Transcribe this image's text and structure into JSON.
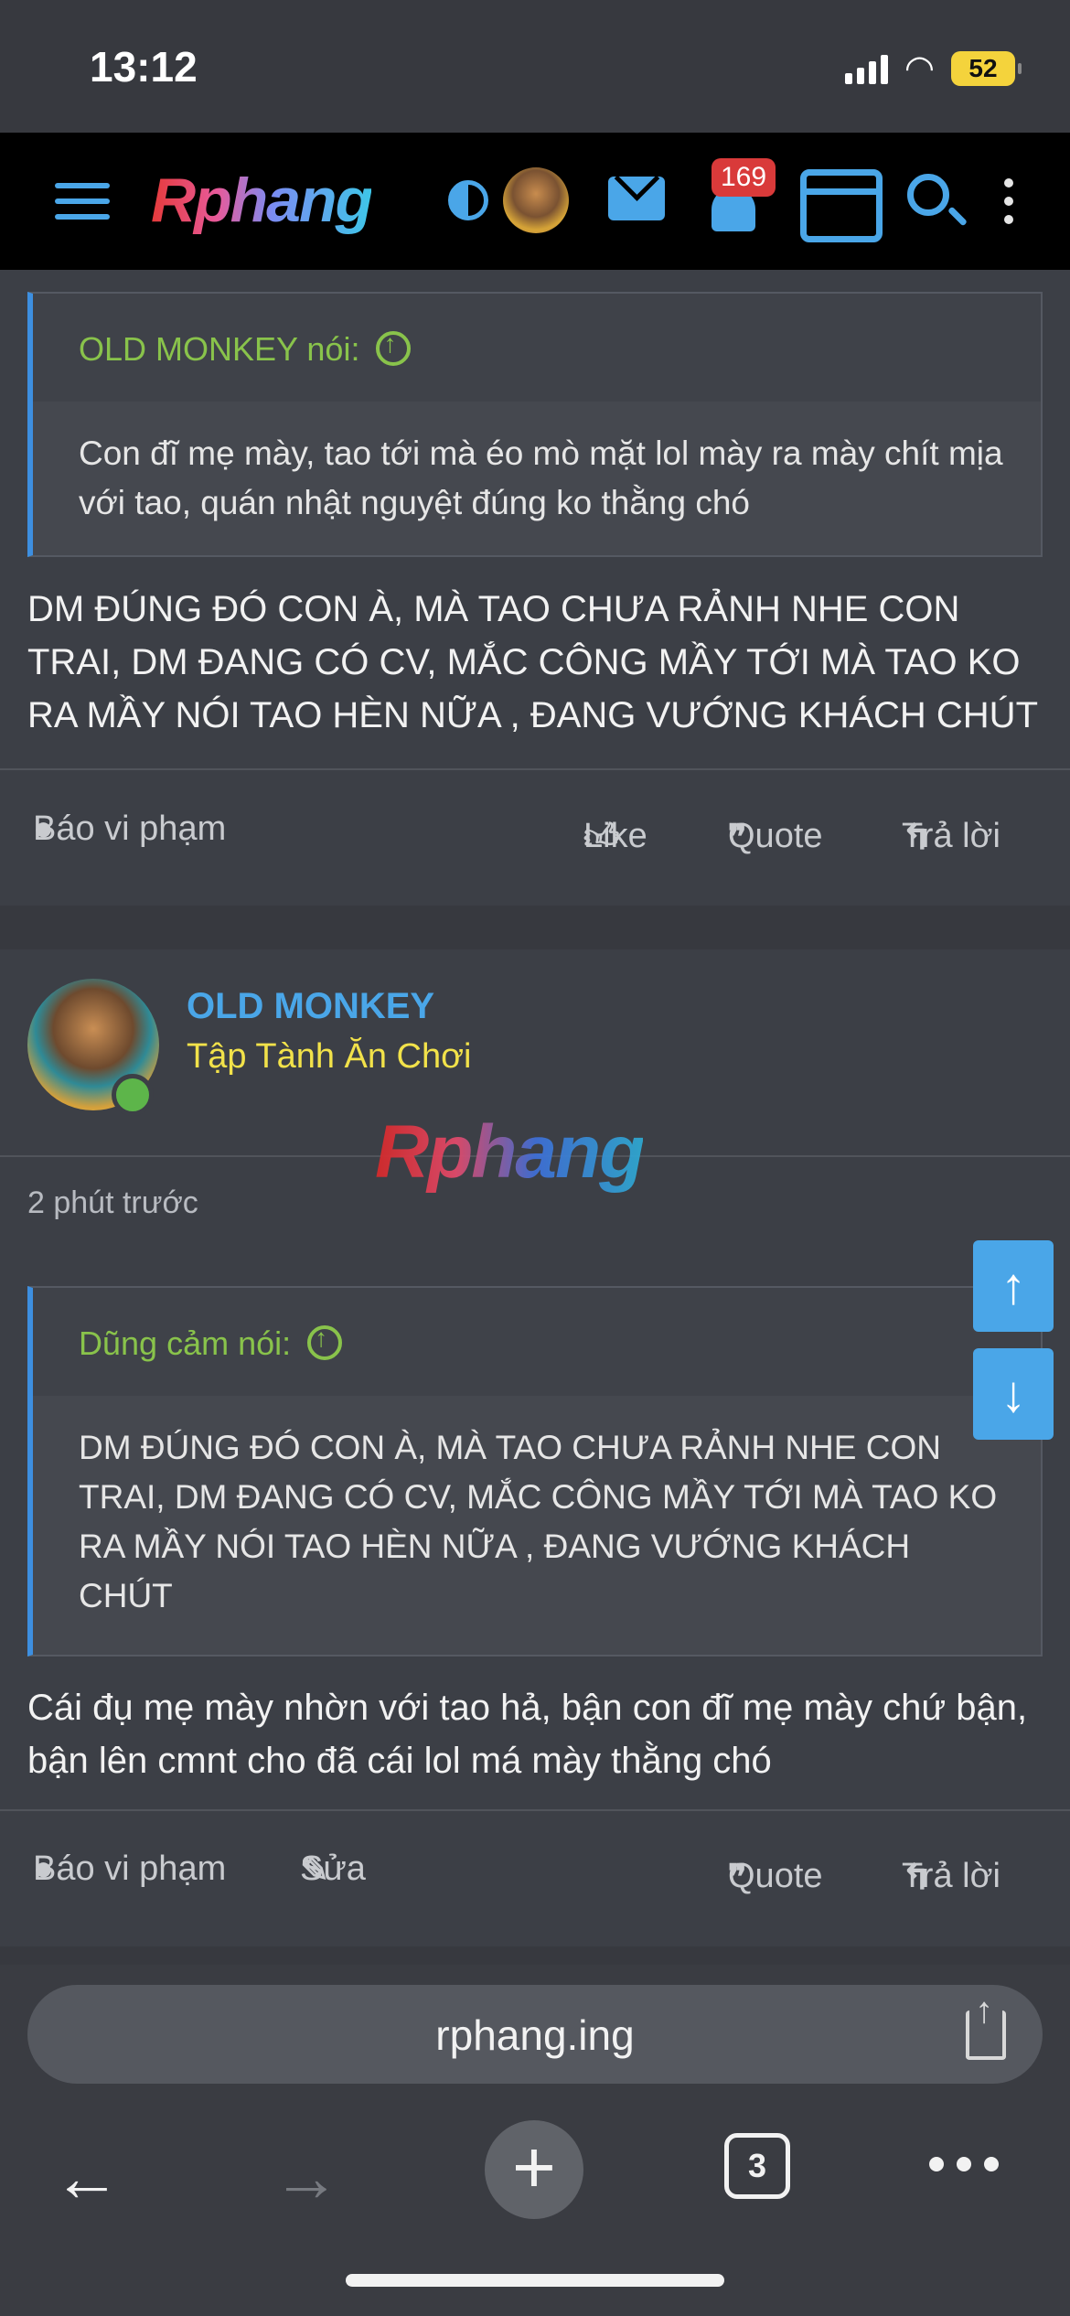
{
  "status_bar": {
    "time": "13:12",
    "battery": "52"
  },
  "nav": {
    "logo": "Rphang",
    "notification_count": "169"
  },
  "post1": {
    "quote_author": "OLD MONKEY nói:",
    "quote_text": "Con đĩ mẹ mày, tao tới mà éo mò mặt lol mày ra mày chít mịa với tao, quán nhật nguyệt đúng ko thằng chó",
    "message": "DM ĐÚNG ĐÓ CON À, MÀ TAO CHƯA RẢNH NHE CON TRAI, DM ĐANG CÓ CV, MẮC CÔNG MẦY TỚI MÀ TAO KO RA MẦY NÓI TAO HÈN NỮA , ĐANG VƯỚNG KHÁCH CHÚT",
    "actions": {
      "report": "Báo vi phạm",
      "like": "Like",
      "quote": "Quote",
      "reply": "Trả lời"
    }
  },
  "post2": {
    "username": "OLD MONKEY",
    "user_title": "Tập Tành Ăn Chơi",
    "watermark": "Rphang",
    "time_ago": "2 phút trước",
    "quote_author": "Dũng cảm nói:",
    "quote_text": "DM ĐÚNG ĐÓ CON À, MÀ TAO CHƯA RẢNH NHE CON TRAI, DM ĐANG CÓ CV, MẮC CÔNG MẦY TỚI MÀ TAO KO RA MẦY NÓI TAO HÈN NỮA , ĐANG VƯỚNG KHÁCH CHÚT",
    "message": "Cái đụ mẹ mày nhờn với tao hả, bận con đĩ mẹ mày chứ bận, bận lên cmnt cho đã cái lol má mày thằng chó",
    "actions": {
      "report": "Báo vi phạm",
      "edit": "Sửa",
      "quote": "Quote",
      "reply": "Trả lời"
    }
  },
  "browser": {
    "url": "rphang.ing",
    "tab_count": "3"
  },
  "colors": {
    "accent": "#4aa6e8",
    "quote_author": "#89c34b",
    "user_title": "#f2e24a",
    "badge": "#d93a3a"
  }
}
